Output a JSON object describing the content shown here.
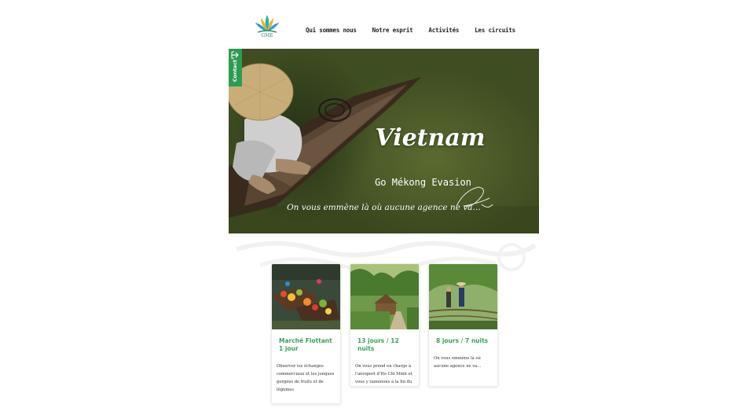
{
  "header": {
    "logo_text": "GME",
    "nav": [
      {
        "label": "Qui sommes nous"
      },
      {
        "label": "Notre esprit"
      },
      {
        "label": "Activités"
      },
      {
        "label": "Les circuits"
      }
    ]
  },
  "contact_tab": {
    "label": "Contact",
    "icon": "arrow-right-icon"
  },
  "hero": {
    "title": "Vietnam",
    "subtitle": "Go Mékong Evasion",
    "tagline": "On vous emmène là où aucune agence ne va…",
    "signature": "Phương"
  },
  "cards": [
    {
      "title": "Marché Flottant 1 jour",
      "description": "Observer les échanges commerciaux et les jonques gorgées de fruits et de légumes",
      "image": "floating-market-photo"
    },
    {
      "title": "13 jours / 12 nuits",
      "description": "On vous prend en charge à l'aéroport d'Ho Chi Minh et vous y ramenons à la fin du séjour.",
      "image": "village-path-photo"
    },
    {
      "title": "8 jours / 7 nuits",
      "description": "On vous emmène là où aucune agence ne va…",
      "image": "monkey-bridge-photo"
    }
  ],
  "colors": {
    "accent_green": "#3aa05a",
    "contact_green": "#2e9b52",
    "hero_olive": "#4a5a28"
  }
}
